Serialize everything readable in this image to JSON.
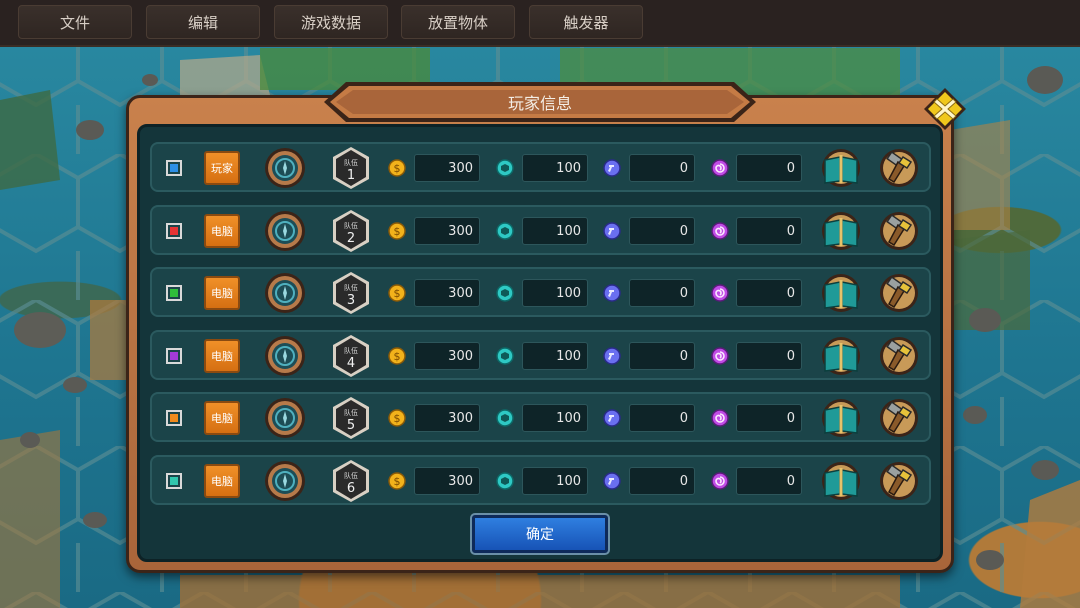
{
  "menu": [
    "文件",
    "编辑",
    "游戏数据",
    "放置物体",
    "触发器"
  ],
  "dialog": {
    "title": "玩家信息",
    "confirm_label": "确定",
    "team_prefix": "队伍"
  },
  "resource_icons": [
    "gold-coin-icon",
    "cyan-gem-icon",
    "hammer-badge-icon",
    "purple-spiral-icon"
  ],
  "colors": {
    "gold": "#f2b21b",
    "cyan": "#2ec9c4",
    "blue_violet": "#6a6ff0",
    "magenta": "#c04be6",
    "orange_button": "#e57e1c",
    "confirm_blue": "#2567cc"
  },
  "players": [
    {
      "color": "#2d8fe6",
      "type": "玩家",
      "team": "1",
      "res": [
        "300",
        "100",
        "0",
        "0"
      ]
    },
    {
      "color": "#e53434",
      "type": "电脑",
      "team": "2",
      "res": [
        "300",
        "100",
        "0",
        "0"
      ]
    },
    {
      "color": "#2fbf3a",
      "type": "电脑",
      "team": "3",
      "res": [
        "300",
        "100",
        "0",
        "0"
      ]
    },
    {
      "color": "#a23ad8",
      "type": "电脑",
      "team": "4",
      "res": [
        "300",
        "100",
        "0",
        "0"
      ]
    },
    {
      "color": "#f08a1c",
      "type": "电脑",
      "team": "5",
      "res": [
        "300",
        "100",
        "0",
        "0"
      ]
    },
    {
      "color": "#31c7ae",
      "type": "电脑",
      "team": "6",
      "res": [
        "300",
        "100",
        "0",
        "0"
      ]
    }
  ]
}
